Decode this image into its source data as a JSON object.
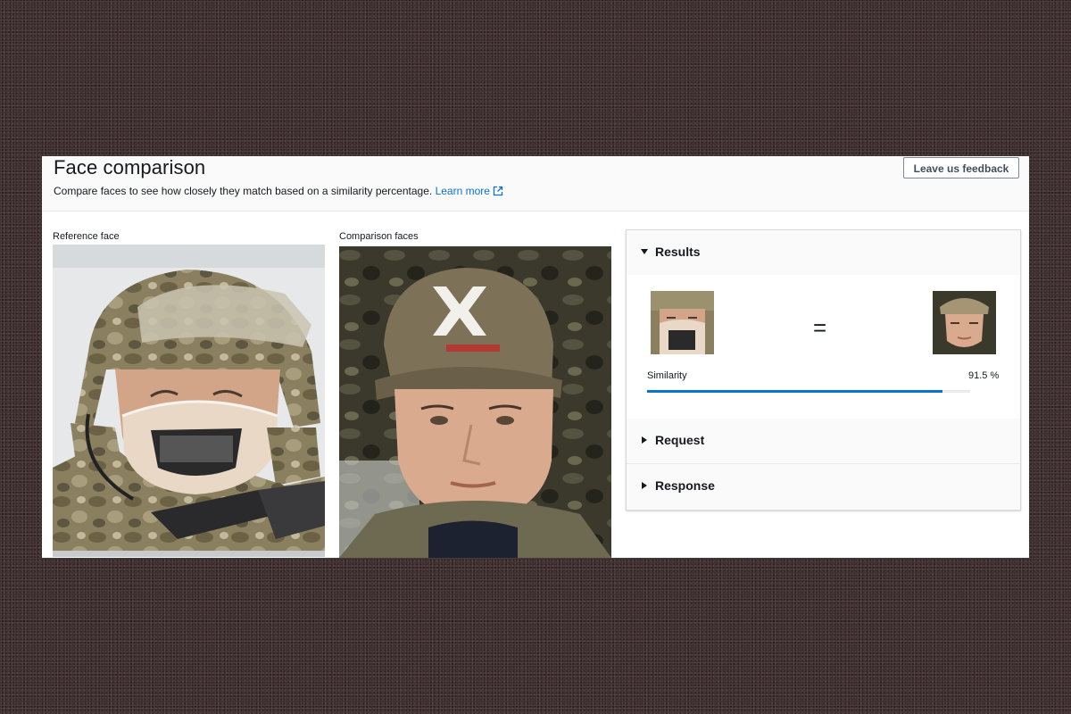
{
  "page": {
    "title": "Face comparison",
    "description": "Compare faces to see how closely they match based on a similarity percentage.",
    "learn_more": "Learn more",
    "feedback_button": "Leave us feedback"
  },
  "reference": {
    "label": "Reference face"
  },
  "comparison": {
    "label": "Comparison faces"
  },
  "results": {
    "title": "Results",
    "operator": "=",
    "similarity_label": "Similarity",
    "similarity_text": "91.5 %",
    "similarity_fraction": 0.915
  },
  "sections": {
    "request": "Request",
    "response": "Response"
  },
  "colors": {
    "accent": "#0972d3",
    "text": "#16191f",
    "border": "#7d8998"
  },
  "icons": [
    "external-link-icon",
    "caret-down-icon",
    "caret-right-icon"
  ]
}
